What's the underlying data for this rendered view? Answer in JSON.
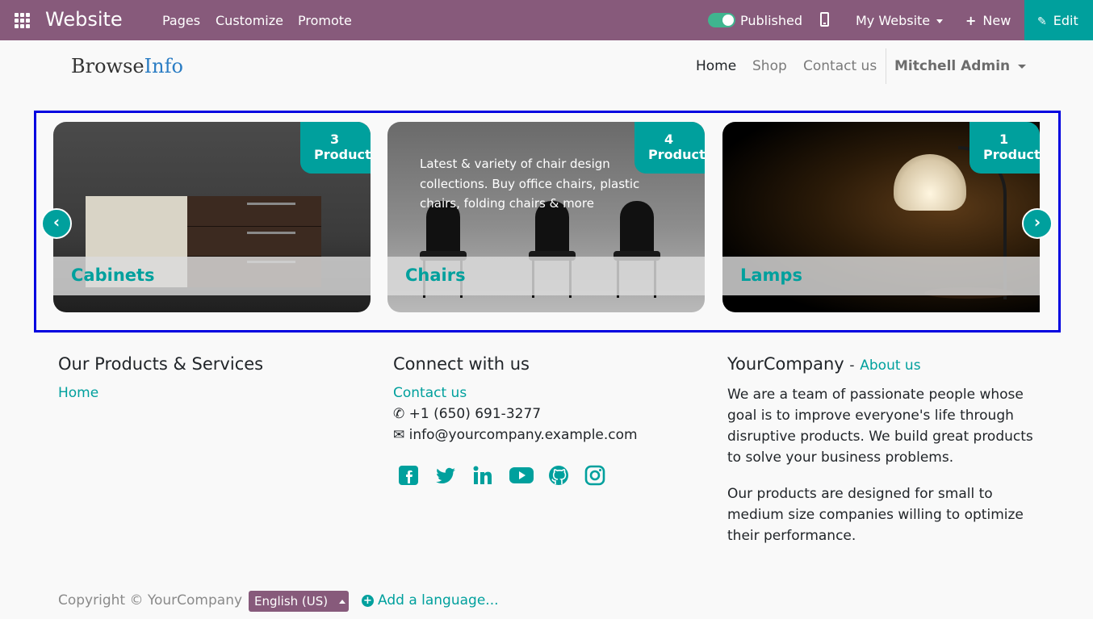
{
  "topbar": {
    "app_name": "Website",
    "menu": [
      "Pages",
      "Customize",
      "Promote"
    ],
    "published_label": "Published",
    "website_selector": "My Website",
    "new_label": "New",
    "edit_label": "Edit",
    "color": "#875a7b"
  },
  "header": {
    "logo_part1": "Browse",
    "logo_part2": "Info",
    "nav": [
      "Home",
      "Shop",
      "Contact us"
    ],
    "user": "Mitchell Admin"
  },
  "categories": [
    {
      "name": "Cabinets",
      "count": "3",
      "unit": "Products"
    },
    {
      "name": "Chairs",
      "count": "4",
      "unit": "Products",
      "description": "Latest & variety of chair design collections. Buy office chairs, plastic chairs, folding chairs & more"
    },
    {
      "name": "Lamps",
      "count": "1",
      "unit": "Products"
    }
  ],
  "footer": {
    "products_title": "Our Products & Services",
    "products_link": "Home",
    "connect_title": "Connect with us",
    "contact_link": "Contact us",
    "phone": "+1 (650) 691-3277",
    "email": "info@yourcompany.example.com",
    "company_title": "YourCompany",
    "about_link": "About us",
    "about_p1": "We are a team of passionate people whose goal is to improve everyone's life through disruptive products. We build great products to solve your business problems.",
    "about_p2": "Our products are designed for small to medium size companies willing to optimize their performance.",
    "social": [
      "facebook-icon",
      "twitter-icon",
      "linkedin-icon",
      "youtube-icon",
      "github-icon",
      "instagram-icon"
    ]
  },
  "bottom": {
    "copyright": "Copyright © YourCompany",
    "language": "English (US)",
    "add_language": "Add a language..."
  },
  "colors": {
    "accent": "#00a09d",
    "highlight_border": "#0000e0"
  }
}
